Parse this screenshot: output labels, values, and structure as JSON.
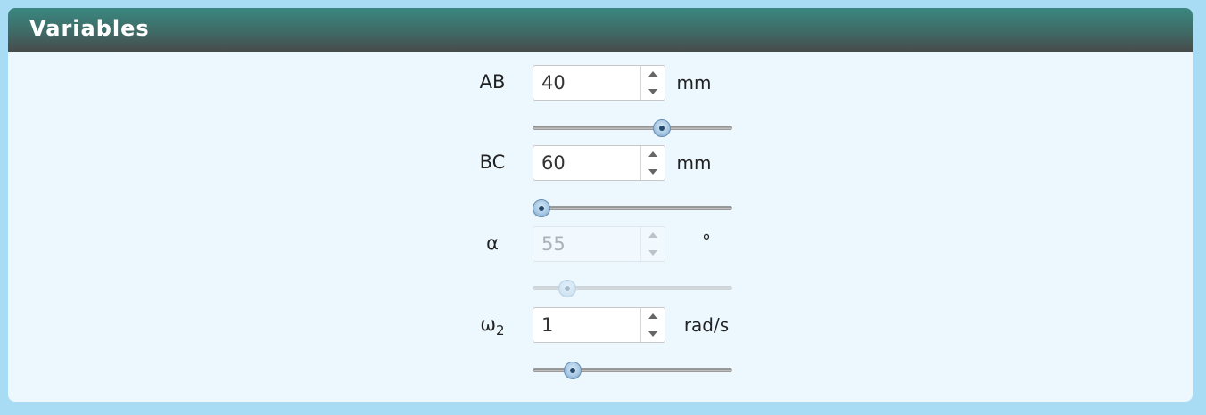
{
  "panel": {
    "title": "Variables"
  },
  "variables": [
    {
      "label": "AB",
      "value": "40",
      "unit": "mm",
      "slider_fraction": 0.66,
      "enabled": true
    },
    {
      "label": "BC",
      "value": "60",
      "unit": "mm",
      "slider_fraction": 0.0,
      "enabled": true
    },
    {
      "label": "α",
      "value": "55",
      "unit": "°",
      "slider_fraction": 0.14,
      "enabled": false
    },
    {
      "label": "ω",
      "label_sub": "2",
      "value": "1",
      "unit": "rad/s",
      "slider_fraction": 0.17,
      "enabled": true
    }
  ]
}
